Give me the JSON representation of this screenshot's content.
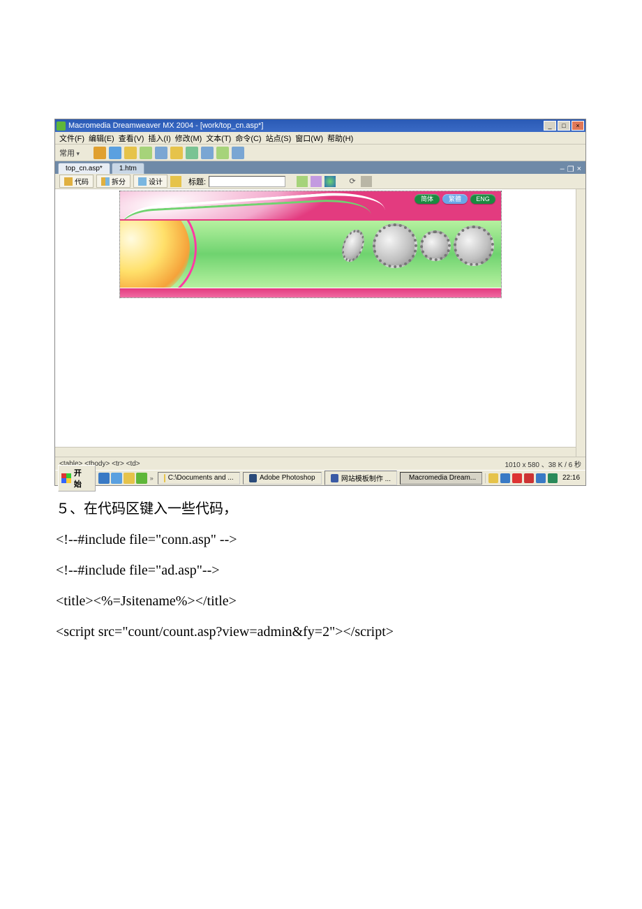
{
  "app": {
    "title": "Macromedia Dreamweaver MX 2004 - [work/top_cn.asp*]"
  },
  "menus": {
    "file": "文件(F)",
    "edit": "编辑(E)",
    "view": "查看(V)",
    "insert": "插入(I)",
    "modify": "修改(M)",
    "text": "文本(T)",
    "commands": "命令(C)",
    "site": "站点(S)",
    "window": "窗口(W)",
    "help": "帮助(H)"
  },
  "toolbar": {
    "category": "常用"
  },
  "tabs": {
    "t1": "top_cn.asp*",
    "t2": "1.htm"
  },
  "docbar": {
    "code": "代码",
    "split": "拆分",
    "design": "设计",
    "titleLabel": "标题:",
    "titleValue": ""
  },
  "banner": {
    "btn1": "简体",
    "btn2": "繁體",
    "btn3": "ENG"
  },
  "tagSelector": "<table> <tbody> <tr> <td>",
  "status": "1010 x 580 、38 K / 6 秒",
  "taskbar": {
    "start": "开始",
    "t1": "C:\\Documents and ...",
    "t2": "Adobe Photoshop",
    "t3": "网站模板制作 ...",
    "t4": "Macromedia Dream...",
    "clock": "22:16"
  },
  "article": {
    "step": "５、在代码区键入一些代码，",
    "l1": "<!--#include file=\"conn.asp\" -->",
    "l2": "<!--#include file=\"ad.asp\"-->",
    "l3": "<title><%=Jsitename%></title>",
    "l4": "<script src=\"count/count.asp?view=admin&fy=2\"></script>"
  }
}
